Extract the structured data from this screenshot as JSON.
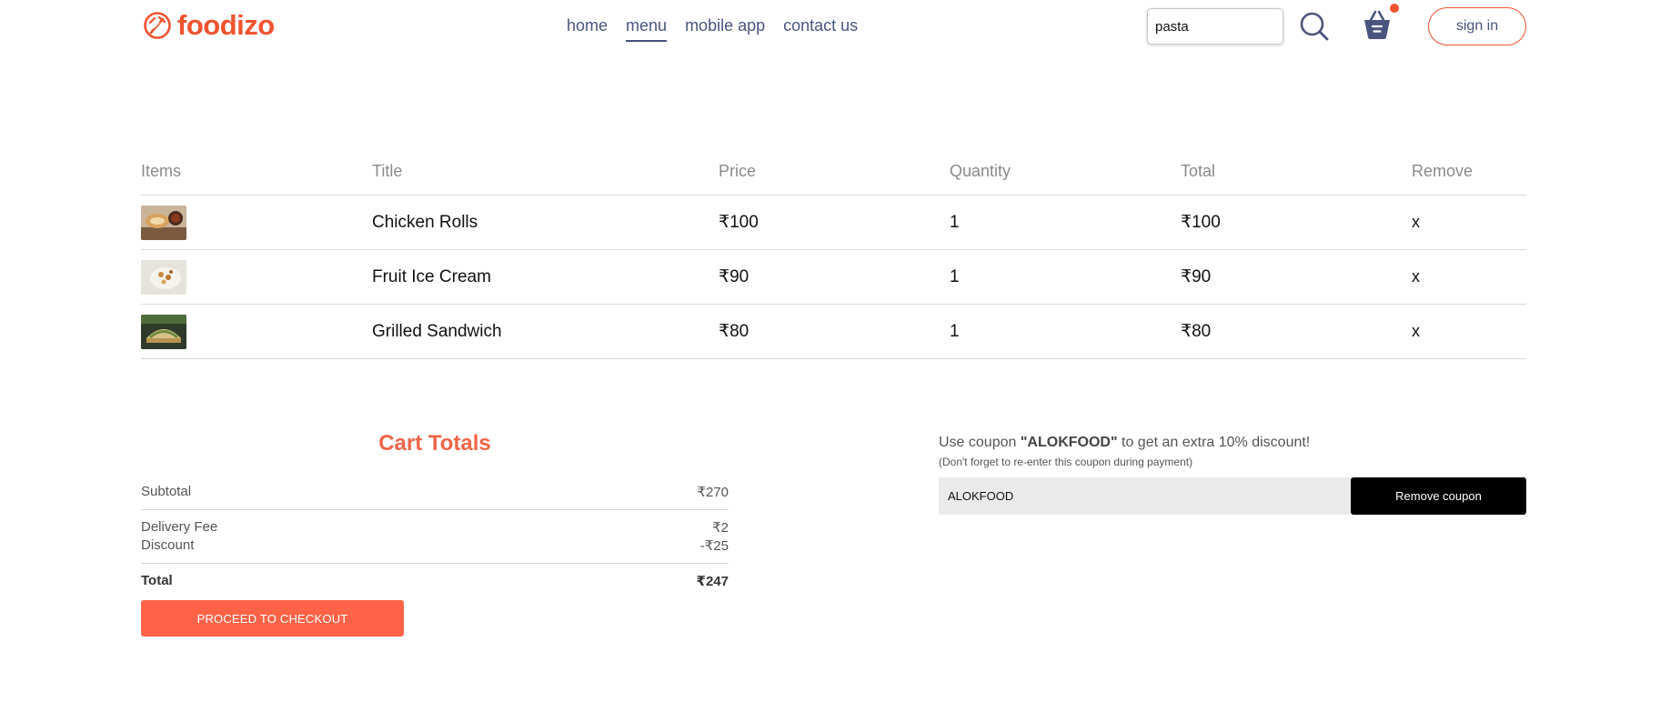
{
  "brand": {
    "name": "foodizo",
    "accent": "#f0532f"
  },
  "nav": {
    "items": [
      {
        "label": "home"
      },
      {
        "label": "menu",
        "active": true
      },
      {
        "label": "mobile app"
      },
      {
        "label": "contact us"
      }
    ]
  },
  "search": {
    "value": "pasta"
  },
  "cart_badge": {
    "color": "#f0532f"
  },
  "signin": {
    "label": "sign in"
  },
  "table": {
    "headers": [
      "Items",
      "Title",
      "Price",
      "Quantity",
      "Total",
      "Remove"
    ],
    "rows": [
      {
        "title": "Chicken Rolls",
        "price": "₹100",
        "quantity": "1",
        "total": "₹100",
        "remove": "x"
      },
      {
        "title": "Fruit Ice Cream",
        "price": "₹90",
        "quantity": "1",
        "total": "₹90",
        "remove": "x"
      },
      {
        "title": "Grilled Sandwich",
        "price": "₹80",
        "quantity": "1",
        "total": "₹80",
        "remove": "x"
      }
    ]
  },
  "totals": {
    "title": "Cart Totals",
    "subtotal_label": "Subtotal",
    "subtotal_value": "₹270",
    "delivery_label": "Delivery Fee",
    "delivery_value": "₹2",
    "discount_label": "Discount",
    "discount_value": "-₹25",
    "total_label": "Total",
    "total_value": "₹247",
    "checkout_label": "PROCEED TO CHECKOUT"
  },
  "coupon": {
    "text_before": "Use coupon ",
    "code_highlight": "\"ALOKFOOD\"",
    "text_after": " to get an extra 10% discount!",
    "note": "(Don't forget to re-enter this coupon during payment)",
    "input_value": "ALOKFOOD",
    "button_label": "Remove coupon"
  }
}
